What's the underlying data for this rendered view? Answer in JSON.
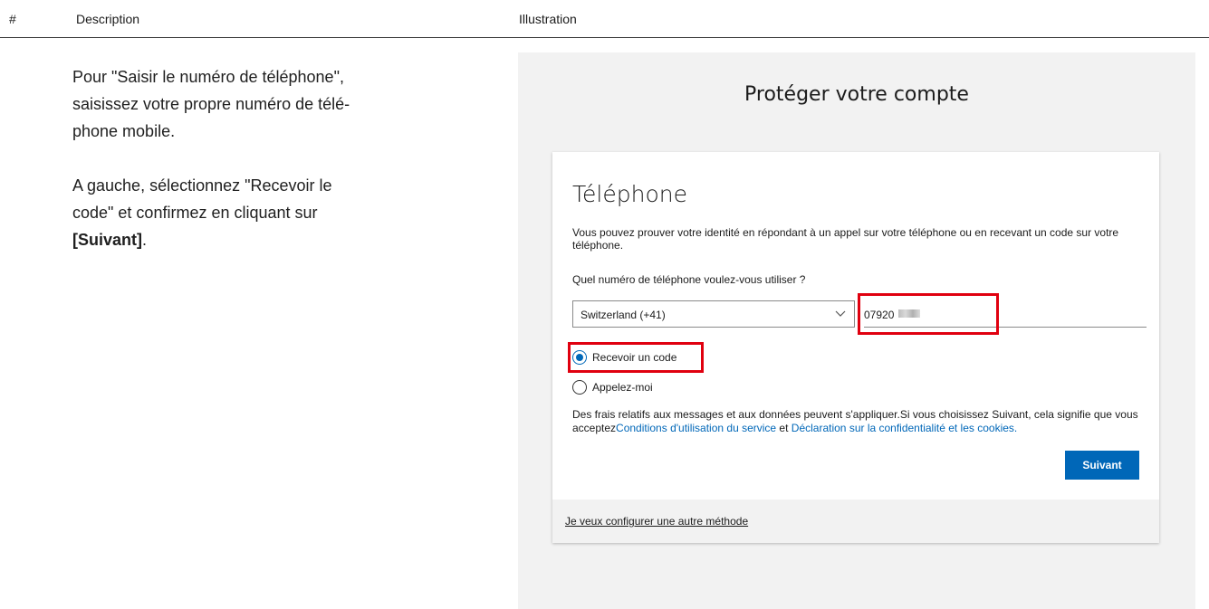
{
  "table_header": {
    "number": "#",
    "description": "Description",
    "illustration": "Illustration"
  },
  "description": {
    "paragraph1": "Pour \"Saisir le numéro de téléphone\",\nsaisissez votre propre numéro de télé-\nphone mobile.",
    "paragraph2_text": "A gauche, sélectionnez \"Recevoir le\ncode\" et confirmez en cliquant sur\n",
    "paragraph2_bold": "[Suivant]",
    "paragraph2_end": "."
  },
  "illustration": {
    "page_title": "Protéger votre compte",
    "card": {
      "title": "Téléphone",
      "subtitle": "Vous pouvez prouver votre identité en répondant à un appel sur votre téléphone ou en recevant un code sur votre téléphone.",
      "question": "Quel numéro de téléphone voulez-vous utiliser ?",
      "country_select": "Switzerland (+41)",
      "phone_value": "07920",
      "radio_receive_code": "Recevoir un code",
      "radio_call_me": "Appelez-moi",
      "legal_text": "Des frais relatifs aux messages et aux données peuvent s'appliquer.Si vous choisissez Suivant, cela signifie que vous acceptez",
      "terms_link": "Conditions d'utilisation du service",
      "legal_and": " et ",
      "privacy_link": "Déclaration sur la confidentialité et les cookies.",
      "next_button": "Suivant",
      "other_method_link": "Je veux configurer une autre méthode"
    },
    "highlight_color": "#e0000f",
    "accent_color": "#0067b8"
  }
}
